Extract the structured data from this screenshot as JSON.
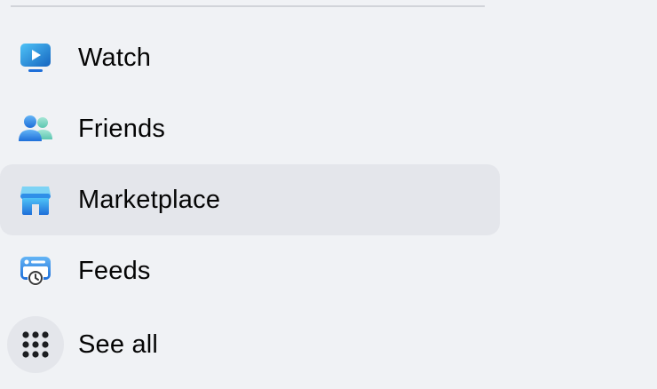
{
  "sidebar": {
    "items": [
      {
        "label": "Watch",
        "icon": "watch-icon"
      },
      {
        "label": "Friends",
        "icon": "friends-icon"
      },
      {
        "label": "Marketplace",
        "icon": "marketplace-icon",
        "active": true
      },
      {
        "label": "Feeds",
        "icon": "feeds-icon"
      },
      {
        "label": "See all",
        "icon": "grid-icon"
      }
    ]
  },
  "colors": {
    "background": "#f0f2f5",
    "active_row": "#e4e6eb",
    "text": "#050505",
    "accent_blue": "#1877f2"
  }
}
